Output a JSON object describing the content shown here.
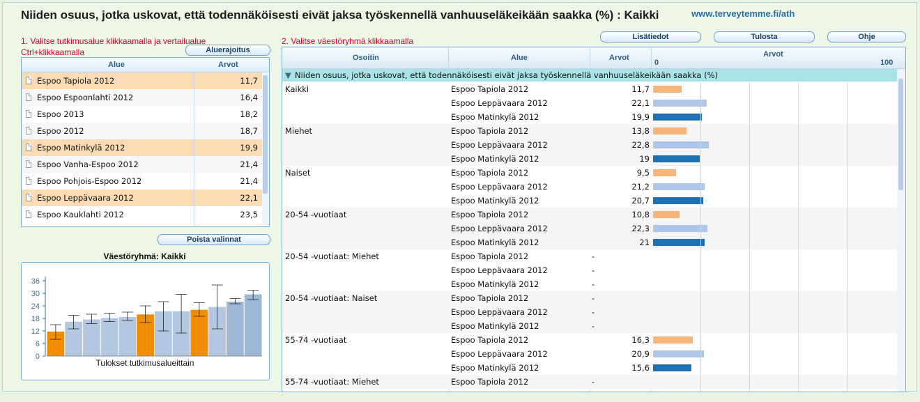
{
  "header": {
    "title": "Niiden osuus, jotka uskovat, että todennäköisesti eivät jaksa työskennellä vanhuuseläkeikään saakka (%) : Kaikki",
    "site": "www.terveytemme.fi/ath"
  },
  "left": {
    "instruction_line1": "1. Valitse tutkimusalue klikkaamalla ja vertailualue",
    "instruction_line2": "Ctrl+klikkaamalla",
    "batch_button": "Aluerajoitus",
    "col_area": "Alue",
    "col_value": "Arvot",
    "rows": [
      {
        "name": "Espoo Tapiola 2012",
        "value": "11,7",
        "selected": true
      },
      {
        "name": "Espoo Espoonlahti 2012",
        "value": "16,4",
        "selected": false
      },
      {
        "name": "Espoo 2013",
        "value": "18,2",
        "selected": false
      },
      {
        "name": "Espoo 2012",
        "value": "18,7",
        "selected": false
      },
      {
        "name": "Espoo Matinkylä 2012",
        "value": "19,9",
        "selected": true
      },
      {
        "name": "Espoo Vanha-Espoo 2012",
        "value": "21,4",
        "selected": false
      },
      {
        "name": "Espoo Pohjois-Espoo 2012",
        "value": "21,4",
        "selected": false
      },
      {
        "name": "Espoo Leppävaara 2012",
        "value": "22,1",
        "selected": true
      },
      {
        "name": "Espoo Kauklahti 2012",
        "value": "23,5",
        "selected": false
      }
    ],
    "clear_button": "Poista valinnat"
  },
  "chart_data": {
    "type": "bar",
    "title": "Väestöryhmä: Kaikki",
    "xlabel": "Tulokset tutkimusalueittain",
    "ylabel": "",
    "yticks": [
      "0",
      "6",
      "12",
      "18",
      "24",
      "30",
      "36"
    ],
    "ylim": [
      0,
      38
    ],
    "values": [
      11.7,
      16.4,
      17.5,
      18.2,
      18.7,
      19.9,
      21.4,
      21.4,
      22.1,
      23.5,
      26.0,
      29.5
    ],
    "ci_low": [
      8,
      13,
      15.5,
      16.5,
      17,
      16,
      12,
      11,
      19,
      13,
      25,
      27
    ],
    "ci_high": [
      15,
      19.5,
      20,
      20.5,
      21,
      24,
      26,
      29.5,
      25.5,
      34,
      27.5,
      31.5
    ],
    "highlight": [
      true,
      false,
      false,
      false,
      false,
      true,
      false,
      false,
      true,
      false,
      false,
      false
    ],
    "colors": {
      "highlight": "#f18d00",
      "normal": "#b3c8e0",
      "dark": "#9db7d6"
    }
  },
  "right": {
    "instruction": "2. Valitse väestöryhmä klikkaamalla",
    "buttons": {
      "info": "Lisätiedot",
      "print": "Tulosta",
      "help": "Ohje"
    },
    "columns": {
      "indicator": "Osoitin",
      "area": "Alue",
      "values": "Arvot",
      "bar_header": "Arvot",
      "axis_min": "0",
      "axis_max": "100"
    },
    "group_title": "Niiden osuus, jotka uskovat, että todennäköisesti eivät jaksa työskennellä vanhuuseläkeikään saakka (%)",
    "series_colors": [
      "#f8b57a",
      "#aec7e8",
      "#1f71b5"
    ],
    "groups": [
      {
        "label": "Kaikki",
        "rows": [
          {
            "area": "Espoo Tapiola 2012",
            "value": "11,7",
            "num": 11.7
          },
          {
            "area": "Espoo Leppävaara 2012",
            "value": "22,1",
            "num": 22.1
          },
          {
            "area": "Espoo Matinkylä 2012",
            "value": "19,9",
            "num": 19.9
          }
        ]
      },
      {
        "label": "Miehet",
        "rows": [
          {
            "area": "Espoo Tapiola 2012",
            "value": "13,8",
            "num": 13.8
          },
          {
            "area": "Espoo Leppävaara 2012",
            "value": "22,8",
            "num": 22.8
          },
          {
            "area": "Espoo Matinkylä 2012",
            "value": "19",
            "num": 19
          }
        ]
      },
      {
        "label": "Naiset",
        "rows": [
          {
            "area": "Espoo Tapiola 2012",
            "value": "9,5",
            "num": 9.5
          },
          {
            "area": "Espoo Leppävaara 2012",
            "value": "21,2",
            "num": 21.2
          },
          {
            "area": "Espoo Matinkylä 2012",
            "value": "20,7",
            "num": 20.7
          }
        ]
      },
      {
        "label": "20-54 -vuotiaat",
        "rows": [
          {
            "area": "Espoo Tapiola 2012",
            "value": "10,8",
            "num": 10.8
          },
          {
            "area": "Espoo Leppävaara 2012",
            "value": "22,3",
            "num": 22.3
          },
          {
            "area": "Espoo Matinkylä 2012",
            "value": "21",
            "num": 21
          }
        ]
      },
      {
        "label": "20-54 -vuotiaat: Miehet",
        "rows": [
          {
            "area": "Espoo Tapiola 2012",
            "value": "-",
            "num": null
          },
          {
            "area": "Espoo Leppävaara 2012",
            "value": "-",
            "num": null
          },
          {
            "area": "Espoo Matinkylä 2012",
            "value": "-",
            "num": null
          }
        ]
      },
      {
        "label": "20-54 -vuotiaat: Naiset",
        "rows": [
          {
            "area": "Espoo Tapiola 2012",
            "value": "-",
            "num": null
          },
          {
            "area": "Espoo Leppävaara 2012",
            "value": "-",
            "num": null
          },
          {
            "area": "Espoo Matinkylä 2012",
            "value": "-",
            "num": null
          }
        ]
      },
      {
        "label": "55-74 -vuotiaat",
        "rows": [
          {
            "area": "Espoo Tapiola 2012",
            "value": "16,3",
            "num": 16.3
          },
          {
            "area": "Espoo Leppävaara 2012",
            "value": "20,9",
            "num": 20.9
          },
          {
            "area": "Espoo Matinkylä 2012",
            "value": "15,6",
            "num": 15.6
          }
        ]
      },
      {
        "label": "55-74 -vuotiaat: Miehet",
        "rows": [
          {
            "area": "Espoo Tapiola 2012",
            "value": "-",
            "num": null
          }
        ]
      }
    ]
  }
}
